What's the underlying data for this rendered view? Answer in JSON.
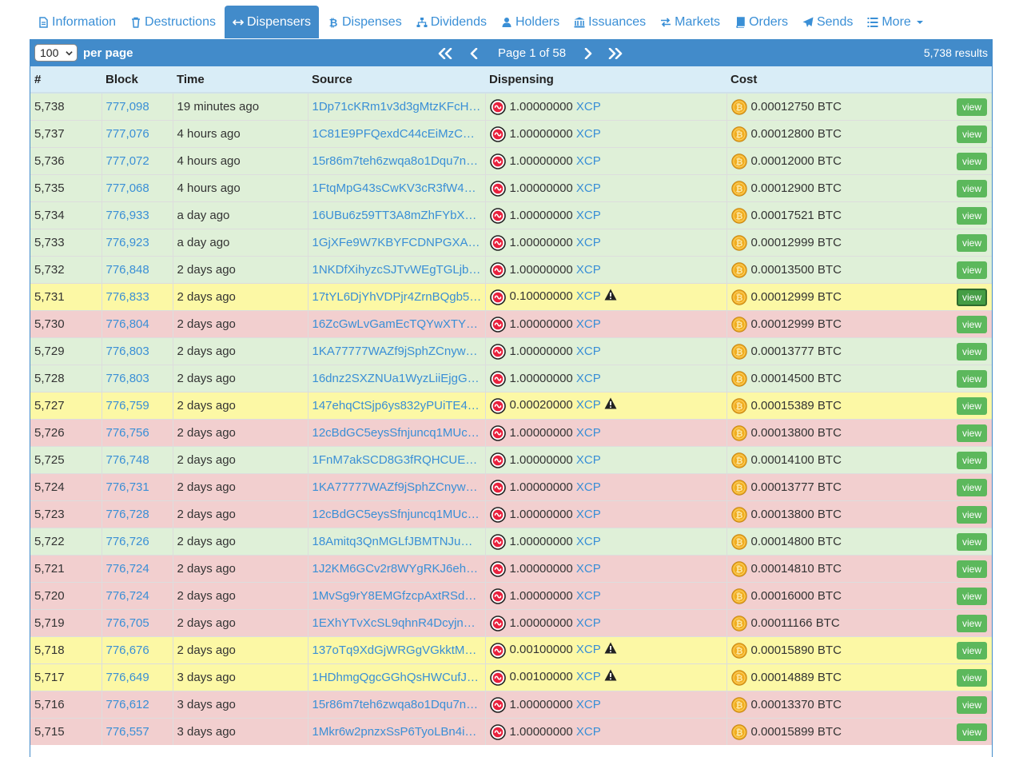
{
  "tabs": [
    {
      "label": "Information",
      "icon": "file-text-icon",
      "active": false
    },
    {
      "label": "Destructions",
      "icon": "trash-icon",
      "active": false
    },
    {
      "label": "Dispensers",
      "icon": "arrows-horizontal-icon",
      "active": true
    },
    {
      "label": "Dispenses",
      "icon": "bitcoin-icon",
      "active": false
    },
    {
      "label": "Dividends",
      "icon": "sitemap-icon",
      "active": false
    },
    {
      "label": "Holders",
      "icon": "user-icon",
      "active": false
    },
    {
      "label": "Issuances",
      "icon": "bank-icon",
      "active": false
    },
    {
      "label": "Markets",
      "icon": "exchange-icon",
      "active": false
    },
    {
      "label": "Orders",
      "icon": "book-icon",
      "active": false
    },
    {
      "label": "Sends",
      "icon": "paper-plane-icon",
      "active": false
    },
    {
      "label": "More",
      "icon": "list-icon",
      "active": false,
      "dropdown": true
    }
  ],
  "pager": {
    "per_page_value": "100",
    "per_page_label": "per page",
    "page_text": "Page 1 of 58",
    "results_text": "5,738 results"
  },
  "table": {
    "columns": [
      "#",
      "Block",
      "Time",
      "Source",
      "Dispensing",
      "Cost"
    ],
    "view_label": "view",
    "rows": [
      {
        "num": "5,738",
        "block": "777,098",
        "time": "19 minutes ago",
        "source": "1Dp71cKRm1v3d3gMtzKFcH…",
        "amount": "1.00000000",
        "asset": "XCP",
        "warning": false,
        "cost": "0.00012750 BTC",
        "status": "green",
        "focused": false
      },
      {
        "num": "5,737",
        "block": "777,076",
        "time": "4 hours ago",
        "source": "1C81E9PFQexdC44cEiMzCK…",
        "amount": "1.00000000",
        "asset": "XCP",
        "warning": false,
        "cost": "0.00012800 BTC",
        "status": "green",
        "focused": false
      },
      {
        "num": "5,736",
        "block": "777,072",
        "time": "4 hours ago",
        "source": "15r86m7teh6zwqa8o1Dqu7nr…",
        "amount": "1.00000000",
        "asset": "XCP",
        "warning": false,
        "cost": "0.00012000 BTC",
        "status": "green",
        "focused": false
      },
      {
        "num": "5,735",
        "block": "777,068",
        "time": "4 hours ago",
        "source": "1FtqMpG43sCwKV3cR3fW4a…",
        "amount": "1.00000000",
        "asset": "XCP",
        "warning": false,
        "cost": "0.00012900 BTC",
        "status": "green",
        "focused": false
      },
      {
        "num": "5,734",
        "block": "776,933",
        "time": "a day ago",
        "source": "16UBu6z59TT3A8mZhFYbX…",
        "amount": "1.00000000",
        "asset": "XCP",
        "warning": false,
        "cost": "0.00017521 BTC",
        "status": "green",
        "focused": false
      },
      {
        "num": "5,733",
        "block": "776,923",
        "time": "a day ago",
        "source": "1GjXFe9W7KBYFCDNPGXA…",
        "amount": "1.00000000",
        "asset": "XCP",
        "warning": false,
        "cost": "0.00012999 BTC",
        "status": "green",
        "focused": false
      },
      {
        "num": "5,732",
        "block": "776,848",
        "time": "2 days ago",
        "source": "1NKDfXihyzcSJTvWEgTGLjb…",
        "amount": "1.00000000",
        "asset": "XCP",
        "warning": false,
        "cost": "0.00013500 BTC",
        "status": "green",
        "focused": false
      },
      {
        "num": "5,731",
        "block": "776,833",
        "time": "2 days ago",
        "source": "17tYL6DjYhVDPjr4ZrnBQgb5…",
        "amount": "0.10000000",
        "asset": "XCP",
        "warning": true,
        "cost": "0.00012999 BTC",
        "status": "yellow",
        "focused": true
      },
      {
        "num": "5,730",
        "block": "776,804",
        "time": "2 days ago",
        "source": "16ZcGwLvGamEcTQYwXTYn…",
        "amount": "1.00000000",
        "asset": "XCP",
        "warning": false,
        "cost": "0.00012999 BTC",
        "status": "red",
        "focused": false
      },
      {
        "num": "5,729",
        "block": "776,803",
        "time": "2 days ago",
        "source": "1KA77777WAZf9jSphZCnyw…",
        "amount": "1.00000000",
        "asset": "XCP",
        "warning": false,
        "cost": "0.00013777 BTC",
        "status": "green",
        "focused": false
      },
      {
        "num": "5,728",
        "block": "776,803",
        "time": "2 days ago",
        "source": "16dnz2SXZNUa1WyzLiiEjgG…",
        "amount": "1.00000000",
        "asset": "XCP",
        "warning": false,
        "cost": "0.00014500 BTC",
        "status": "green",
        "focused": false
      },
      {
        "num": "5,727",
        "block": "776,759",
        "time": "2 days ago",
        "source": "147ehqCtSjp6ys832yPUiTE4…",
        "amount": "0.00020000",
        "asset": "XCP",
        "warning": true,
        "cost": "0.00015389 BTC",
        "status": "yellow",
        "focused": false
      },
      {
        "num": "5,726",
        "block": "776,756",
        "time": "2 days ago",
        "source": "12cBdGC5eysSfnjuncq1MUc…",
        "amount": "1.00000000",
        "asset": "XCP",
        "warning": false,
        "cost": "0.00013800 BTC",
        "status": "red",
        "focused": false
      },
      {
        "num": "5,725",
        "block": "776,748",
        "time": "2 days ago",
        "source": "1FnM7akSCD8G3fRQHCUE…",
        "amount": "1.00000000",
        "asset": "XCP",
        "warning": false,
        "cost": "0.00014100 BTC",
        "status": "green",
        "focused": false
      },
      {
        "num": "5,724",
        "block": "776,731",
        "time": "2 days ago",
        "source": "1KA77777WAZf9jSphZCnyw…",
        "amount": "1.00000000",
        "asset": "XCP",
        "warning": false,
        "cost": "0.00013777 BTC",
        "status": "red",
        "focused": false
      },
      {
        "num": "5,723",
        "block": "776,728",
        "time": "2 days ago",
        "source": "12cBdGC5eysSfnjuncq1MUc…",
        "amount": "1.00000000",
        "asset": "XCP",
        "warning": false,
        "cost": "0.00013800 BTC",
        "status": "red",
        "focused": false
      },
      {
        "num": "5,722",
        "block": "776,726",
        "time": "2 days ago",
        "source": "18Amitq3QnMGLfJBMTNJu…",
        "amount": "1.00000000",
        "asset": "XCP",
        "warning": false,
        "cost": "0.00014800 BTC",
        "status": "green",
        "focused": false
      },
      {
        "num": "5,721",
        "block": "776,724",
        "time": "2 days ago",
        "source": "1J2KM6GCv2r8WYgRKJ6eh…",
        "amount": "1.00000000",
        "asset": "XCP",
        "warning": false,
        "cost": "0.00014810 BTC",
        "status": "red",
        "focused": false
      },
      {
        "num": "5,720",
        "block": "776,724",
        "time": "2 days ago",
        "source": "1MvSg9rY8EMGfzcpAxtRSd7…",
        "amount": "1.00000000",
        "asset": "XCP",
        "warning": false,
        "cost": "0.00016000 BTC",
        "status": "red",
        "focused": false
      },
      {
        "num": "5,719",
        "block": "776,705",
        "time": "2 days ago",
        "source": "1EXhYTvXcSL9qhnR4DcyjnU…",
        "amount": "1.00000000",
        "asset": "XCP",
        "warning": false,
        "cost": "0.00011166 BTC",
        "status": "red",
        "focused": false
      },
      {
        "num": "5,718",
        "block": "776,676",
        "time": "2 days ago",
        "source": "137oTq9XdGjWRGgVGkktMq…",
        "amount": "0.00100000",
        "asset": "XCP",
        "warning": true,
        "cost": "0.00015890 BTC",
        "status": "yellow",
        "focused": false
      },
      {
        "num": "5,717",
        "block": "776,649",
        "time": "3 days ago",
        "source": "1HDhmgQgcGGhQsHWCufJ…",
        "amount": "0.00100000",
        "asset": "XCP",
        "warning": true,
        "cost": "0.00014889 BTC",
        "status": "yellow",
        "focused": false
      },
      {
        "num": "5,716",
        "block": "776,612",
        "time": "3 days ago",
        "source": "15r86m7teh6zwqa8o1Dqu7nr…",
        "amount": "1.00000000",
        "asset": "XCP",
        "warning": false,
        "cost": "0.00013370 BTC",
        "status": "red",
        "focused": false
      },
      {
        "num": "5,715",
        "block": "776,557",
        "time": "3 days ago",
        "source": "1Mkr6w2pnzxSsP6TyoLBn4i…",
        "amount": "1.00000000",
        "asset": "XCP",
        "warning": false,
        "cost": "0.00015899 BTC",
        "status": "red",
        "focused": false
      }
    ]
  },
  "colors": {
    "accent": "#428bca",
    "link": "#3a8fd6",
    "row_green": "#dff0d8",
    "row_yellow": "#fcf8a5",
    "row_red": "#f2cfcf",
    "view_button": "#5cb85c"
  }
}
